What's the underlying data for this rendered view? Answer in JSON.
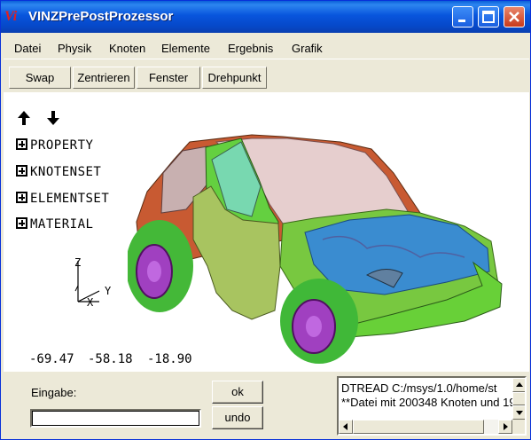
{
  "window": {
    "title": "VINZPrePostProzessor",
    "icon_text": "Vi"
  },
  "menu": {
    "items": [
      "Datei",
      "Physik",
      "Knoten",
      "Elemente",
      "Ergebnis",
      "Grafik"
    ]
  },
  "toolbar": {
    "buttons": [
      "Swap",
      "Zentrieren",
      "Fenster",
      "Drehpunkt"
    ]
  },
  "viewport": {
    "tree": [
      "PROPERTY",
      "KNOTENSET",
      "ELEMENTSET",
      "MATERIAL"
    ],
    "axes": {
      "z": "Z",
      "x": "X",
      "y": "Y"
    },
    "coords": [
      "-69.47",
      "-58.18",
      "-18.90"
    ]
  },
  "input_panel": {
    "label": "Eingabe:",
    "value": "",
    "ok_label": "ok",
    "undo_label": "undo"
  },
  "log": {
    "lines": [
      "DTREAD C:/msys/1.0/home/st",
      "**Datei mit 200348 Knoten und 19"
    ]
  },
  "colors": {
    "titlebar": "#0A54DC",
    "close_button": "#D44A2A"
  }
}
